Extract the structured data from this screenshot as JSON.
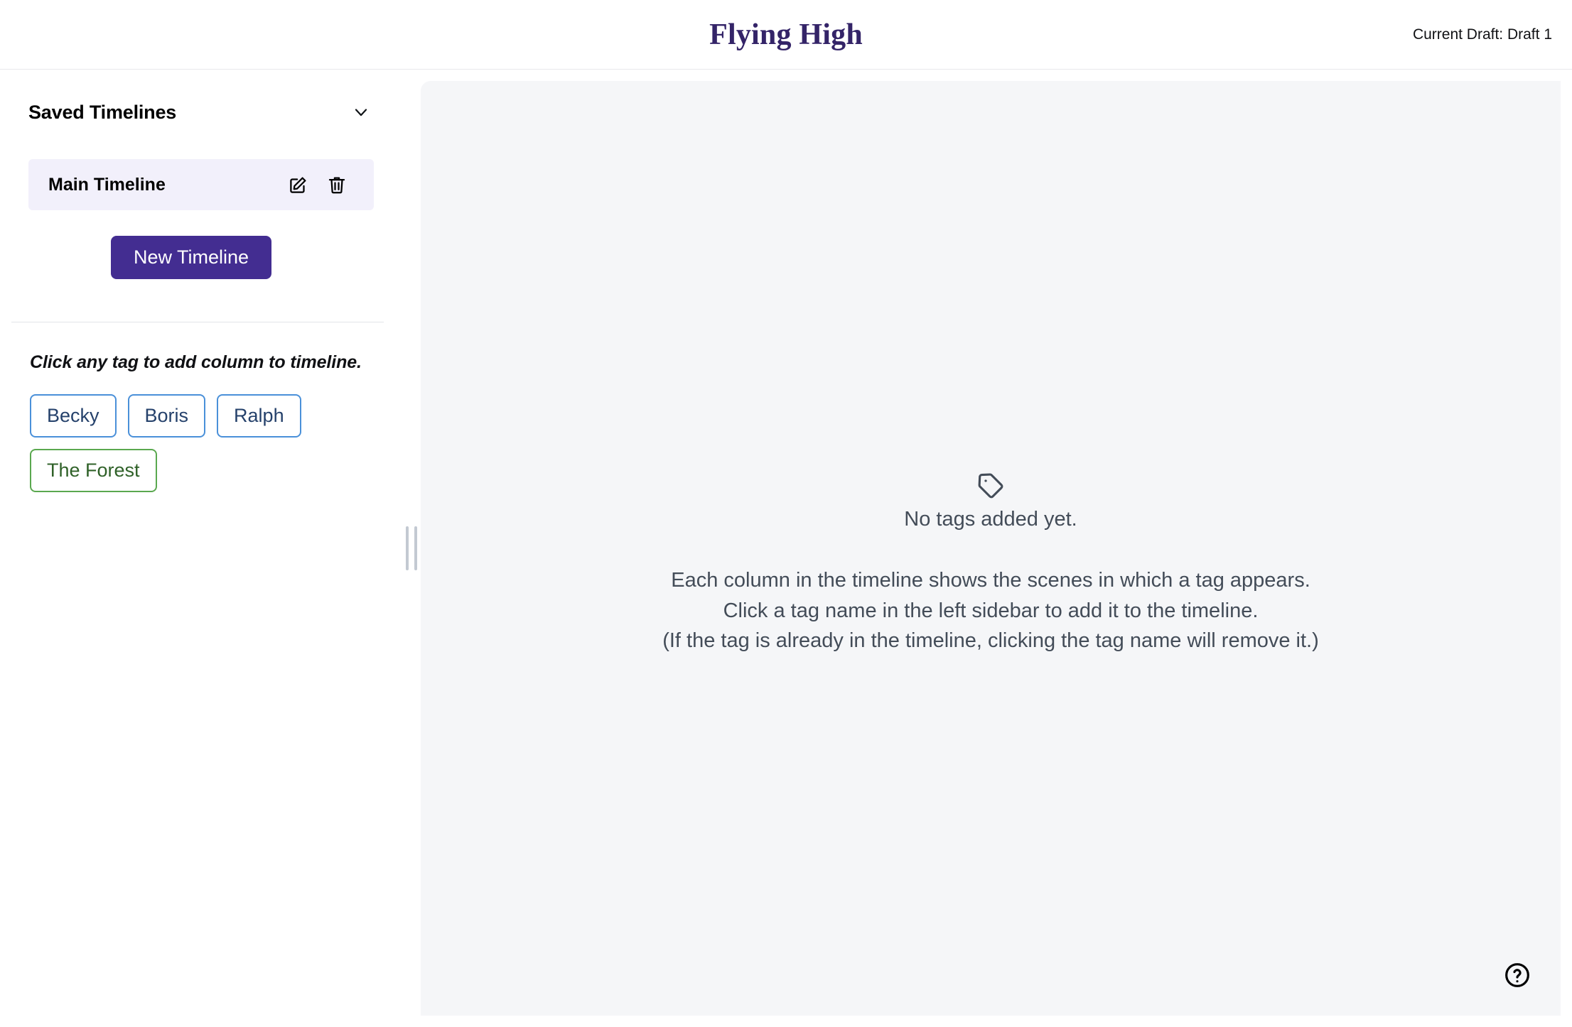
{
  "header": {
    "title": "Flying High",
    "draft_status": "Current Draft: Draft 1"
  },
  "sidebar": {
    "section_title": "Saved Timelines",
    "collapse_icon": "chevron-down-icon",
    "timelines": [
      {
        "name": "Main Timeline",
        "edit_icon": "edit-pencil-icon",
        "delete_icon": "trash-icon",
        "selected": true
      }
    ],
    "new_timeline_label": "New Timeline",
    "tag_hint": "Click any tag to add column to timeline.",
    "tags": [
      {
        "label": "Becky",
        "color": "#4a90d9",
        "text_color": "#25416b"
      },
      {
        "label": "Boris",
        "color": "#4a90d9",
        "text_color": "#25416b"
      },
      {
        "label": "Ralph",
        "color": "#4a90d9",
        "text_color": "#25416b"
      },
      {
        "label": "The Forest",
        "color": "#5aa84f",
        "text_color": "#2f6128"
      }
    ]
  },
  "main": {
    "empty_icon": "tag-icon",
    "empty_title": "No tags added yet.",
    "empty_lines": [
      "Each column in the timeline shows the scenes in which a tag appears.",
      "Click a tag name in the left sidebar to add it to the timeline.",
      "(If the tag is already in the timeline, clicking the tag name will remove it.)"
    ],
    "help_icon": "question-circle-icon"
  },
  "colors": {
    "brand_purple": "#432d91",
    "title_purple": "#342468",
    "panel_bg": "#f5f6f8",
    "selected_row_bg": "#f2f0fb"
  }
}
